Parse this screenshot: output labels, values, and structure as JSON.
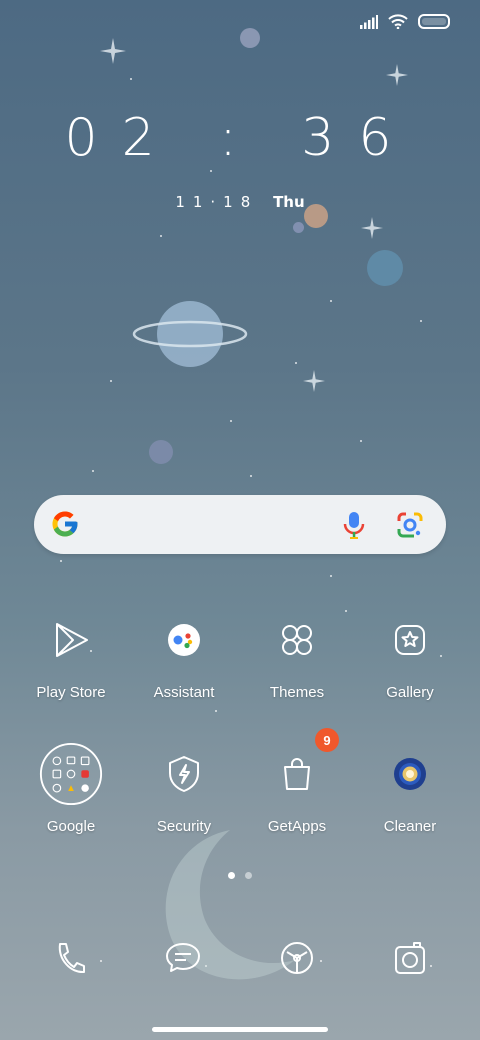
{
  "status_bar": {
    "signal_icon": "signal-bars-icon",
    "wifi_icon": "wifi-icon",
    "battery_icon": "battery-icon"
  },
  "clock": {
    "time": "02 : 36",
    "date": "11·18",
    "weekday": "Thu"
  },
  "search_bar": {
    "logo_icon": "google-g-icon",
    "mic_icon": "microphone-icon",
    "lens_icon": "google-lens-icon"
  },
  "apps": [
    {
      "label": "Play Store",
      "icon": "play-store-icon"
    },
    {
      "label": "Assistant",
      "icon": "assistant-icon"
    },
    {
      "label": "Themes",
      "icon": "themes-icon"
    },
    {
      "label": "Gallery",
      "icon": "gallery-icon"
    },
    {
      "label": "Google",
      "icon": "google-folder-icon"
    },
    {
      "label": "Security",
      "icon": "security-icon"
    },
    {
      "label": "GetApps",
      "icon": "getapps-icon",
      "badge": "9"
    },
    {
      "label": "Cleaner",
      "icon": "cleaner-icon"
    }
  ],
  "page_indicator": {
    "pages": 2,
    "active": 1
  },
  "dock": [
    {
      "icon": "phone-icon"
    },
    {
      "icon": "messages-icon"
    },
    {
      "icon": "browser-icon"
    },
    {
      "icon": "camera-icon"
    }
  ],
  "colors": {
    "badge": "#f0582c",
    "search_bg": "#eef1f3"
  }
}
